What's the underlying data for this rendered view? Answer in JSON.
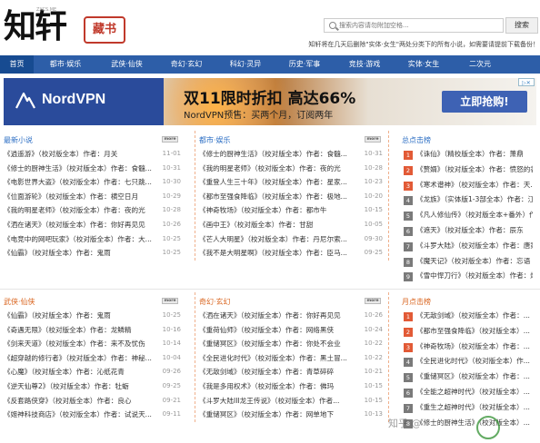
{
  "header": {
    "logo_main": "知轩",
    "logo_seal": "藏书",
    "logo_url": "ZXCS.ME",
    "search_placeholder": "搜索内容请勿附加空格...",
    "search_button": "搜索",
    "tagline": "知轩将在几天后删除\"实体·女生\"两处分类下的所有小说，如需要请提前下载备份！"
  },
  "nav": [
    "首页",
    "都市·娱乐",
    "武侠·仙侠",
    "奇幻·玄幻",
    "科幻·灵异",
    "历史·军事",
    "竞技·游戏",
    "实体·女生",
    "二次元"
  ],
  "ad": {
    "brand": "NordVPN",
    "title": "双11限时折扣 高达66%",
    "subtitle": "NordVPN预售：买两个月，订阅两年",
    "cta": "立即抢购!",
    "close": "广告"
  },
  "more_label": "more",
  "panels": {
    "latest": {
      "title": "最新小说",
      "rows": [
        {
          "t": "《逍遥游》（校对版全本）作者：月关",
          "d": "11-01"
        },
        {
          "t": "《修士的厨神生活》（校对版全本）作者：食髓...",
          "d": "10-31"
        },
        {
          "t": "《电影世界大盗》（校对版全本）作者：七只跳...",
          "d": "10-30"
        },
        {
          "t": "《位面游轮》（校对版全本）作者：横空日月",
          "d": "10-29"
        },
        {
          "t": "《我的明星老师》（校对版全本）作者：夜的光",
          "d": "10-28"
        },
        {
          "t": "《洒在诸天》（校对版全本）作者：你好再见见",
          "d": "10-26"
        },
        {
          "t": "《电竞中的网吧玩家》（校对版全本）作者：大...",
          "d": "10-25"
        },
        {
          "t": "《仙霸》（校对版全本）作者：鬼雨",
          "d": "10-25"
        }
      ]
    },
    "urban": {
      "title": "都市·娱乐",
      "rows": [
        {
          "t": "《修士的厨神生活》（校对版全本）作者：食髓...",
          "d": "10-31"
        },
        {
          "t": "《我的明星老师》（校对版全本）作者：夜的光",
          "d": "10-28"
        },
        {
          "t": "《重登人生三十年》（校对版全本）作者：星家...",
          "d": "10-23"
        },
        {
          "t": "《都市至强食降临》（校对版全本）作者：极地...",
          "d": "10-20"
        },
        {
          "t": "《神奇牧场》（校对版全本）作者：都市牛",
          "d": "10-15"
        },
        {
          "t": "《画中王》（校对版全本）作者：甘甜",
          "d": "10-05"
        },
        {
          "t": "《芒人大明星》（校对版全本）作者：丹尼尔索...",
          "d": "09-30"
        },
        {
          "t": "《我不是大明星啊》（校对版全本）作者：臣马...",
          "d": "09-25"
        }
      ]
    },
    "wuxia": {
      "title": "武侠·仙侠",
      "rows": [
        {
          "t": "《仙霸》（校对版全本）作者：鬼雨",
          "d": "10-25"
        },
        {
          "t": "《奇遇无限》（校对版全本）作者：龙鳞精",
          "d": "10-16"
        },
        {
          "t": "《剑来天道》（校对版全本）作者：来不及忧伤",
          "d": "10-14"
        },
        {
          "t": "《超穿越的修行者》（校对版全本）作者：神秘...",
          "d": "10-04"
        },
        {
          "t": "《心魔》（校对版全本）作者：沁纸花青",
          "d": "09-26"
        },
        {
          "t": "《逆天仙尊2》（校对版全本）作者：牡蛎",
          "d": "09-25"
        },
        {
          "t": "《反套路侠穿》（校对版全本）作者：良心",
          "d": "09-21"
        },
        {
          "t": "《姬神科技商店》（校对版全本）作者：试说天...",
          "d": "09-11"
        }
      ]
    },
    "fantasy": {
      "title": "奇幻·玄幻",
      "rows": [
        {
          "t": "《洒在诸天》（校对版全本）作者：你好再见见",
          "d": "10-26"
        },
        {
          "t": "《重荷仙师》（校对版全本）作者：网络黑侠",
          "d": "10-24"
        },
        {
          "t": "《重储冥区》（校对版全本）作者：你处不会业",
          "d": "10-22"
        },
        {
          "t": "《全民进化时代》（校对版全本）作者：黑土冒...",
          "d": "10-22"
        },
        {
          "t": "《无敌剑域》（校对版全本）作者：青草碎碎",
          "d": "10-21"
        },
        {
          "t": "《我是多用权术》（校对版全本）作者：佛玛",
          "d": "10-15"
        },
        {
          "t": "《斗罗大陆III龙王传说》（校对版全本）作者...",
          "d": "10-15"
        },
        {
          "t": "《重储冥区》（校对版全本）作者：网单地下",
          "d": "10-13"
        }
      ]
    }
  },
  "rank_total": {
    "title": "总点击榜",
    "rows": [
      "《诛仙》（精校版全本）作者：萧鼎",
      "《赘婿》（校对版全本）作者：愤怒的香蕉",
      "《寒术谱神》（校对版全本）作者：天...",
      "《龙族》（实体版1-3部全本）作者：江南",
      "《凡人修仙传》（校对版全本+番外）作...",
      "《遮天》（校对版全本）作者：辰东",
      "《斗罗大陆》（校对版全本）作者：唐家...",
      "《魔天记》（校对版全本）作者：忘语",
      "《雪中悍刀行》（校对版全本）作者：烽火...",
      "《吞噬星空》（校对版全本）作者：我吃..."
    ]
  },
  "rank_month": {
    "title": "月点击榜",
    "rows": [
      "《无敌剑域》（校对版全本）作者：...",
      "《都市至强食降临》（校对版全本）...",
      "《神奇牧场》（校对版全本）作者：...",
      "《全民进化时代》（校对版全本）作...",
      "《重储冥区》（校对版全本）作者：...",
      "《全能之超神时代》（校对版全本）...",
      "《重生之超神时代》（校对版全本）...",
      "《修士的厨神生活》（校对版全本）..."
    ]
  },
  "watermark": "知乎 @"
}
